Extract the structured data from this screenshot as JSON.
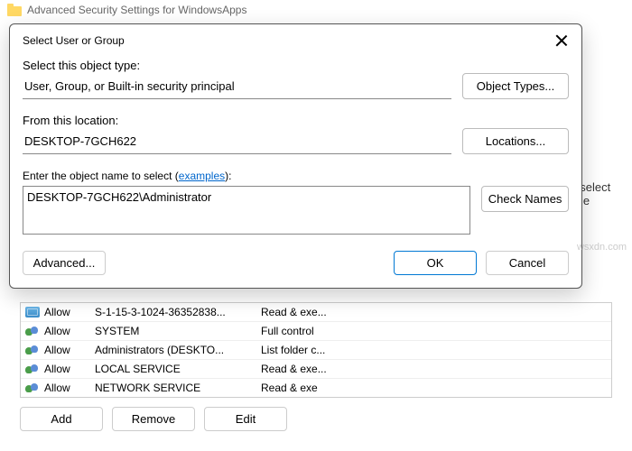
{
  "bg": {
    "title": "Advanced Security Settings for WindowsApps",
    "hint_text": ", select the",
    "perm_rows": [
      {
        "icon": "single",
        "type": "Allow",
        "principal": "S-1-15-3-1024-36352838...",
        "access": "Read & exe..."
      },
      {
        "icon": "two",
        "type": "Allow",
        "principal": "SYSTEM",
        "access": "Full control"
      },
      {
        "icon": "two",
        "type": "Allow",
        "principal": "Administrators (DESKTO...",
        "access": "List folder c..."
      },
      {
        "icon": "two",
        "type": "Allow",
        "principal": "LOCAL SERVICE",
        "access": "Read & exe..."
      },
      {
        "icon": "two",
        "type": "Allow",
        "principal": "NETWORK SERVICE",
        "access": "Read & exe"
      }
    ],
    "buttons": {
      "add": "Add",
      "remove": "Remove",
      "edit": "Edit"
    }
  },
  "dialog": {
    "title": "Select User or Group",
    "object_type_label": "Select this object type:",
    "object_type_value": "User, Group, or Built-in security principal",
    "object_types_btn": "Object Types...",
    "location_label": "From this location:",
    "location_value": "DESKTOP-7GCH622",
    "locations_btn": "Locations...",
    "name_label_pre": "Enter the object name to select (",
    "name_label_link": "examples",
    "name_label_post": "):",
    "name_value": "DESKTOP-7GCH622\\Administrator",
    "check_names_btn": "Check Names",
    "advanced_btn": "Advanced...",
    "ok_btn": "OK",
    "cancel_btn": "Cancel"
  },
  "watermark": "wsxdn.com"
}
